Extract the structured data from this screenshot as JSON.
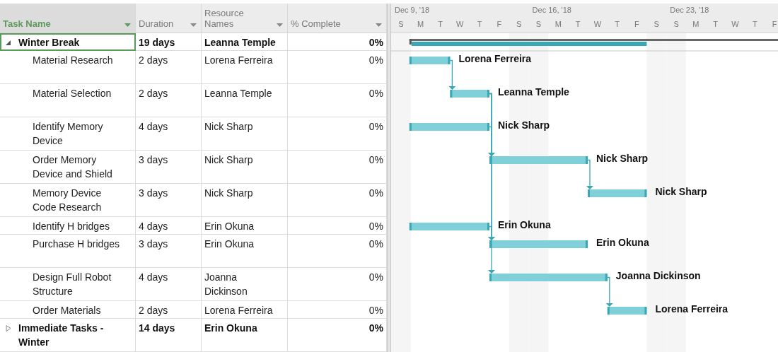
{
  "columns": [
    {
      "label": "Task Name",
      "selected": true
    },
    {
      "label": "Duration",
      "selected": false
    },
    {
      "label": "Resource Names",
      "selected": false
    },
    {
      "label": "% Complete",
      "selected": false
    }
  ],
  "timescale": {
    "weeks": [
      "Dec 9, '18",
      "Dec 16, '18",
      "Dec 23, '18"
    ],
    "days": [
      "S",
      "M",
      "T",
      "W",
      "T",
      "F",
      "S",
      "S",
      "M",
      "T",
      "W",
      "T",
      "F",
      "S",
      "S",
      "M",
      "T",
      "W",
      "T",
      "F"
    ]
  },
  "tasks": [
    {
      "kind": "summary",
      "name": "Winter Break",
      "duration": "19 days",
      "resource": "Leanna Temple",
      "complete": "0%",
      "expanded": true,
      "selected": true,
      "tall": false,
      "children": [
        {
          "kind": "task",
          "name": "Material Research",
          "duration": "2 days",
          "resource": "Lorena Ferreira",
          "complete": "0%",
          "selected": false,
          "tall": true,
          "bar_label": "Lorena Ferreira"
        },
        {
          "kind": "task",
          "name": "Material Selection",
          "duration": "2 days",
          "resource": "Leanna Temple",
          "complete": "0%",
          "selected": false,
          "tall": true,
          "bar_label": "Leanna Temple"
        },
        {
          "kind": "task",
          "name": "Identify Memory Device",
          "duration": "4 days",
          "resource": "Nick Sharp",
          "complete": "0%",
          "selected": false,
          "tall": true,
          "bar_label": "Nick Sharp"
        },
        {
          "kind": "task",
          "name": "Order Memory Device and Shield",
          "duration": "3 days",
          "resource": "Nick Sharp",
          "complete": "0%",
          "selected": false,
          "tall": true,
          "bar_label": "Nick Sharp"
        },
        {
          "kind": "task",
          "name": "Memory Device Code Research",
          "duration": "3 days",
          "resource": "Nick Sharp",
          "complete": "0%",
          "selected": false,
          "tall": true,
          "bar_label": "Nick Sharp"
        },
        {
          "kind": "task",
          "name": "Identify H bridges",
          "duration": "4 days",
          "resource": "Erin Okuna",
          "complete": "0%",
          "selected": false,
          "tall": false,
          "bar_label": "Erin Okuna"
        },
        {
          "kind": "task",
          "name": "Purchase H bridges",
          "duration": "3 days",
          "resource": "Erin Okuna",
          "complete": "0%",
          "selected": false,
          "tall": true,
          "bar_label": "Erin Okuna"
        },
        {
          "kind": "task",
          "name": "Design Full Robot Structure",
          "duration": "4 days",
          "resource": "Joanna Dickinson",
          "complete": "0%",
          "selected": false,
          "tall": true,
          "bar_label": "Joanna Dickinson"
        },
        {
          "kind": "task",
          "name": "Order Materials",
          "duration": "2 days",
          "resource": "Lorena Ferreira",
          "complete": "0%",
          "selected": false,
          "tall": false,
          "bar_label": "Lorena Ferreira"
        }
      ]
    },
    {
      "kind": "summary",
      "name": "Immediate Tasks - Winter",
      "duration": "14 days",
      "resource": "Erin Okuna",
      "complete": "0%",
      "expanded": false,
      "selected": false,
      "tall": true
    }
  ]
}
